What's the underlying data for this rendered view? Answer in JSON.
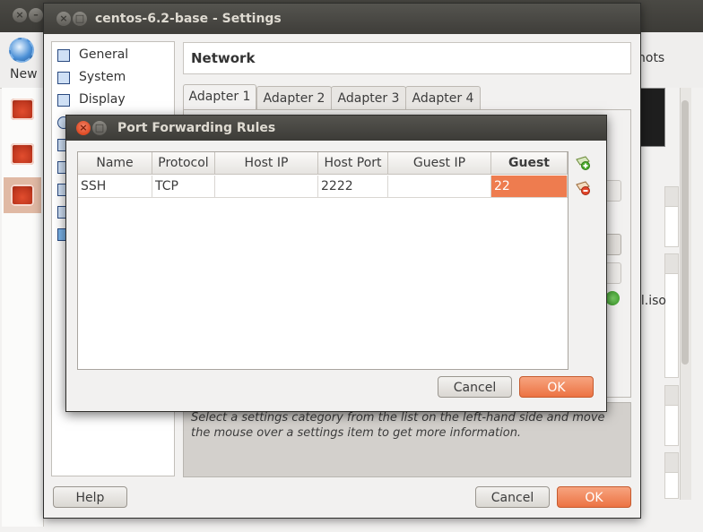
{
  "manager": {
    "new_label": "New",
    "snapshots_label": "hots",
    "iso_label": "ll.iso"
  },
  "settings": {
    "window_title": "centos-6.2-base - Settings",
    "categories": [
      "General",
      "System",
      "Display"
    ],
    "page_title": "Network",
    "tabs": [
      {
        "label": "Adapter 1",
        "active": true
      },
      {
        "label": "Adapter 2",
        "active": false
      },
      {
        "label": "Adapter 3",
        "active": false
      },
      {
        "label": "Adapter 4",
        "active": false
      }
    ],
    "info_text": "Select a settings category from the list on the left-hand side and move the mouse over a settings item to get more information.",
    "help_label": "Help",
    "cancel_label": "Cancel",
    "ok_label": "OK"
  },
  "port_forwarding": {
    "title": "Port Forwarding Rules",
    "columns": [
      "Name",
      "Protocol",
      "Host IP",
      "Host Port",
      "Guest IP",
      "Guest Port"
    ],
    "rows": [
      {
        "name": "SSH",
        "protocol": "TCP",
        "host_ip": "",
        "host_port": "2222",
        "guest_ip": "",
        "guest_port": "22"
      }
    ],
    "cancel_label": "Cancel",
    "ok_label": "OK",
    "add_rule_icon": "add-rule-icon",
    "remove_rule_icon": "remove-rule-icon"
  },
  "colors": {
    "accent_orange": "#ee7c4f",
    "titlebar": "#3c3b37"
  }
}
